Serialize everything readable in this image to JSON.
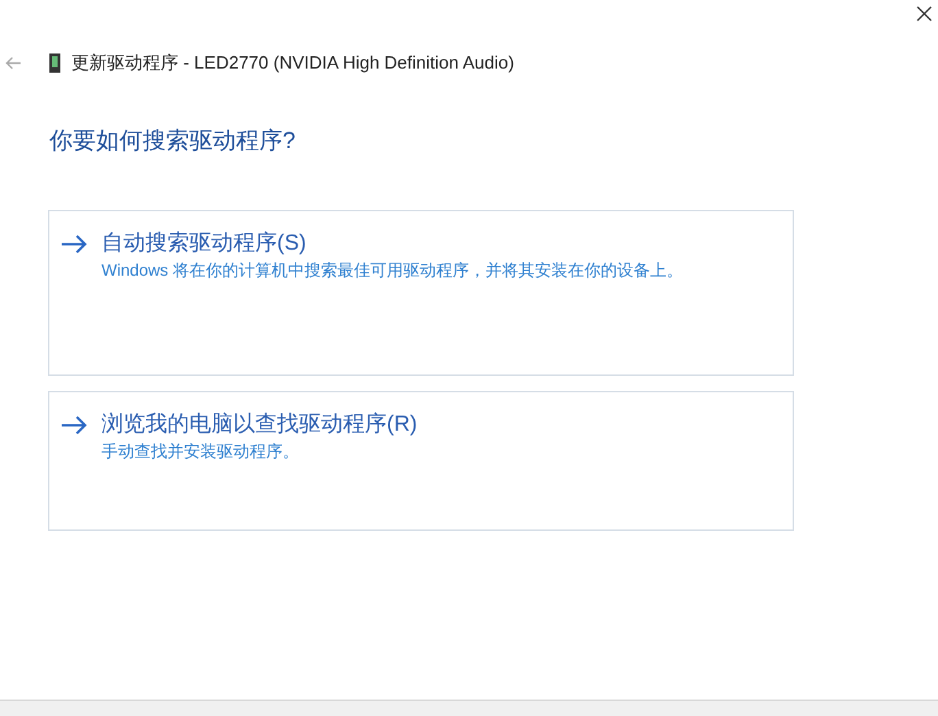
{
  "window": {
    "title": "更新驱动程序 - LED2770 (NVIDIA High Definition Audio)"
  },
  "heading": "你要如何搜索驱动程序?",
  "options": [
    {
      "title": "自动搜索驱动程序(S)",
      "description": "Windows 将在你的计算机中搜索最佳可用驱动程序，并将其安装在你的设备上。"
    },
    {
      "title": "浏览我的电脑以查找驱动程序(R)",
      "description": "手动查找并安装驱动程序。"
    }
  ]
}
